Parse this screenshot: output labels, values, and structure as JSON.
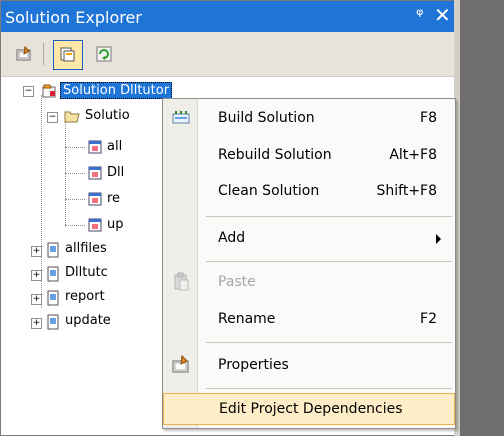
{
  "window": {
    "title": "Solution Explorer",
    "pin_glyph": "ᵠ",
    "close_glyph": "✕"
  },
  "toolbar": {
    "buttons": [
      {
        "icon": "properties-icon"
      },
      {
        "icon": "show-all-files-icon"
      },
      {
        "icon": "refresh-icon"
      }
    ]
  },
  "tree": {
    "root_label": "Solution Dlltutor",
    "solution_items_label": "Solutio",
    "solution_children": [
      "all",
      "Dll",
      "re",
      "up"
    ],
    "projects": [
      "allfiles",
      "Dlltutc",
      "report",
      "update"
    ]
  },
  "context_menu": {
    "items": [
      {
        "label": "Build Solution",
        "shortcut": "F8"
      },
      {
        "label": "Rebuild Solution",
        "shortcut": "Alt+F8"
      },
      {
        "label": "Clean Solution",
        "shortcut": "Shift+F8"
      },
      {
        "label": "Add",
        "shortcut": ""
      },
      {
        "label": "Paste",
        "shortcut": ""
      },
      {
        "label": "Rename",
        "shortcut": "F2"
      },
      {
        "label": "Properties",
        "shortcut": ""
      },
      {
        "label": "Edit Project Dependencies",
        "shortcut": ""
      }
    ]
  },
  "colors": {
    "titlebar": "#1f74d8",
    "highlight_bg": "#fdeec7",
    "highlight_border": "#e8b24d"
  }
}
